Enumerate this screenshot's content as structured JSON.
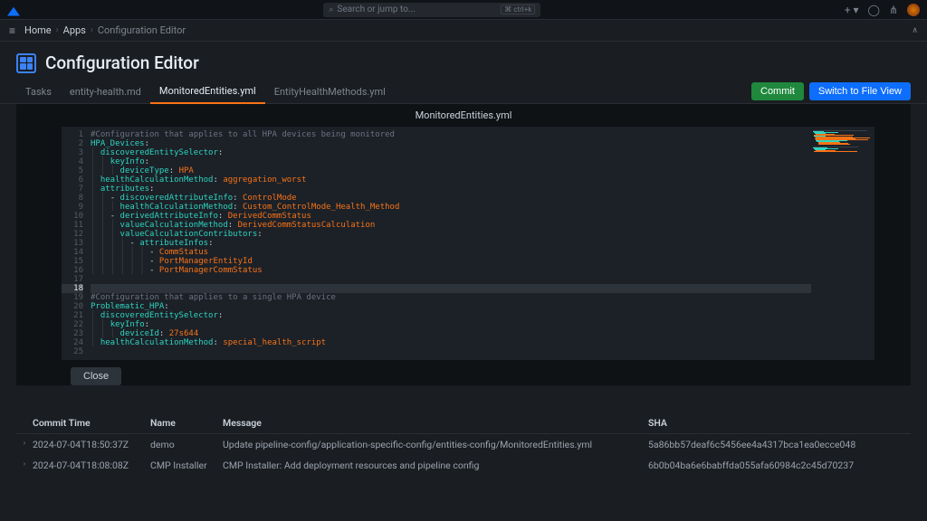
{
  "search": {
    "placeholder": "Search or jump to...",
    "shortcut": "⌘ ctrl+k"
  },
  "breadcrumbs": {
    "home": "Home",
    "apps": "Apps",
    "current": "Configuration Editor"
  },
  "page_title": "Configuration Editor",
  "tabs": {
    "tasks": "Tasks",
    "entity_health": "entity-health.md",
    "monitored": "MonitoredEntities.yml",
    "entity_methods": "EntityHealthMethods.yml"
  },
  "buttons": {
    "commit": "Commit",
    "switch": "Switch to File View",
    "close": "Close"
  },
  "file_name": "MonitoredEntities.yml",
  "code_lines": [
    {
      "n": 1,
      "tokens": [
        {
          "t": "#Configuration that applies to all HPA devices being monitored",
          "c": "cm"
        }
      ]
    },
    {
      "n": 2,
      "tokens": [
        {
          "t": "HPA_Devices",
          "c": "key"
        },
        {
          "t": ":",
          "c": ""
        }
      ]
    },
    {
      "n": 3,
      "tokens": [
        {
          "t": "  ",
          "c": ""
        },
        {
          "t": "discoveredEntitySelector",
          "c": "key"
        },
        {
          "t": ":",
          "c": ""
        }
      ]
    },
    {
      "n": 4,
      "tokens": [
        {
          "t": "    ",
          "c": ""
        },
        {
          "t": "keyInfo",
          "c": "key"
        },
        {
          "t": ":",
          "c": ""
        }
      ]
    },
    {
      "n": 5,
      "tokens": [
        {
          "t": "      ",
          "c": ""
        },
        {
          "t": "deviceType",
          "c": "key"
        },
        {
          "t": ": ",
          "c": ""
        },
        {
          "t": "HPA",
          "c": "str"
        }
      ]
    },
    {
      "n": 6,
      "tokens": [
        {
          "t": "  ",
          "c": ""
        },
        {
          "t": "healthCalculationMethod",
          "c": "key"
        },
        {
          "t": ": ",
          "c": ""
        },
        {
          "t": "aggregation_worst",
          "c": "str"
        }
      ]
    },
    {
      "n": 7,
      "tokens": [
        {
          "t": "  ",
          "c": ""
        },
        {
          "t": "attributes",
          "c": "key"
        },
        {
          "t": ":",
          "c": ""
        }
      ]
    },
    {
      "n": 8,
      "tokens": [
        {
          "t": "    - ",
          "c": ""
        },
        {
          "t": "discoveredAttributeInfo",
          "c": "key"
        },
        {
          "t": ": ",
          "c": ""
        },
        {
          "t": "ControlMode",
          "c": "str"
        }
      ]
    },
    {
      "n": 9,
      "tokens": [
        {
          "t": "      ",
          "c": ""
        },
        {
          "t": "healthCalculationMethod",
          "c": "key"
        },
        {
          "t": ": ",
          "c": ""
        },
        {
          "t": "Custom_ControlMode_Health_Method",
          "c": "str"
        }
      ]
    },
    {
      "n": 10,
      "tokens": [
        {
          "t": "    - ",
          "c": ""
        },
        {
          "t": "derivedAttributeInfo",
          "c": "key"
        },
        {
          "t": ": ",
          "c": ""
        },
        {
          "t": "DerivedCommStatus",
          "c": "str"
        }
      ]
    },
    {
      "n": 11,
      "tokens": [
        {
          "t": "      ",
          "c": ""
        },
        {
          "t": "valueCalculationMethod",
          "c": "key"
        },
        {
          "t": ": ",
          "c": ""
        },
        {
          "t": "DerivedCommStatusCalculation",
          "c": "str"
        }
      ]
    },
    {
      "n": 12,
      "tokens": [
        {
          "t": "      ",
          "c": ""
        },
        {
          "t": "valueCalculationContributors",
          "c": "key"
        },
        {
          "t": ":",
          "c": ""
        }
      ]
    },
    {
      "n": 13,
      "tokens": [
        {
          "t": "        - ",
          "c": ""
        },
        {
          "t": "attributeInfos",
          "c": "key"
        },
        {
          "t": ":",
          "c": ""
        }
      ]
    },
    {
      "n": 14,
      "tokens": [
        {
          "t": "            - ",
          "c": ""
        },
        {
          "t": "CommStatus",
          "c": "str"
        }
      ]
    },
    {
      "n": 15,
      "tokens": [
        {
          "t": "            - ",
          "c": ""
        },
        {
          "t": "PortManagerEntityId",
          "c": "str"
        }
      ]
    },
    {
      "n": 16,
      "tokens": [
        {
          "t": "            - ",
          "c": ""
        },
        {
          "t": "PortManagerCommStatus",
          "c": "str"
        }
      ]
    },
    {
      "n": 17,
      "tokens": [
        {
          "t": "",
          "c": ""
        }
      ]
    },
    {
      "n": 18,
      "tokens": [
        {
          "t": "",
          "c": ""
        }
      ],
      "hl": true
    },
    {
      "n": 19,
      "tokens": [
        {
          "t": "#Configuration that applies to a single HPA device",
          "c": "cm"
        }
      ]
    },
    {
      "n": 20,
      "tokens": [
        {
          "t": "Problematic_HPA",
          "c": "key"
        },
        {
          "t": ":",
          "c": ""
        }
      ]
    },
    {
      "n": 21,
      "tokens": [
        {
          "t": "  ",
          "c": ""
        },
        {
          "t": "discoveredEntitySelector",
          "c": "key"
        },
        {
          "t": ":",
          "c": ""
        }
      ]
    },
    {
      "n": 22,
      "tokens": [
        {
          "t": "    ",
          "c": ""
        },
        {
          "t": "keyInfo",
          "c": "key"
        },
        {
          "t": ":",
          "c": ""
        }
      ]
    },
    {
      "n": 23,
      "tokens": [
        {
          "t": "      ",
          "c": ""
        },
        {
          "t": "deviceId",
          "c": "key"
        },
        {
          "t": ": ",
          "c": ""
        },
        {
          "t": "27s644",
          "c": "str"
        }
      ]
    },
    {
      "n": 24,
      "tokens": [
        {
          "t": "  ",
          "c": ""
        },
        {
          "t": "healthCalculationMethod",
          "c": "key"
        },
        {
          "t": ": ",
          "c": ""
        },
        {
          "t": "special_health_script",
          "c": "str"
        }
      ]
    },
    {
      "n": 25,
      "tokens": [
        {
          "t": "",
          "c": ""
        }
      ]
    }
  ],
  "commits_header": {
    "time": "Commit Time",
    "name": "Name",
    "message": "Message",
    "sha": "SHA"
  },
  "commits": [
    {
      "time": "2024-07-04T18:50:37Z",
      "name": "demo",
      "message": "Update pipeline-config/application-specific-config/entities-config/MonitoredEntities.yml",
      "sha": "5a86bb57deaf6c5456ee4a4317bca1ea0ecce048"
    },
    {
      "time": "2024-07-04T18:08:08Z",
      "name": "CMP Installer",
      "message": "CMP Installer: Add deployment resources and pipeline config",
      "sha": "6b0b04ba6e6babffda055afa60984c2c45d70237"
    }
  ]
}
